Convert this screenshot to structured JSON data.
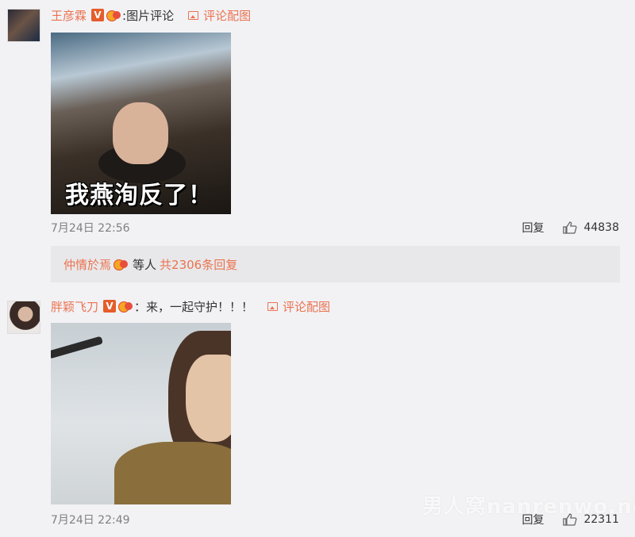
{
  "comments": [
    {
      "username": "王彦霖",
      "verified_badge": "V",
      "text": ":图片评论",
      "pic_comment_label": "评论配图",
      "photo_caption": "我燕洵反了！",
      "timestamp": "7月24日 22:56",
      "reply_label": "回复",
      "like_count": "44838"
    },
    {
      "username": "胖颖飞刀",
      "verified_badge": "V",
      "text": "：来，一起守护！！！",
      "pic_comment_label": "评论配图",
      "timestamp": "7月24日 22:49",
      "reply_label": "回复",
      "like_count": "22311"
    }
  ],
  "replies": {
    "user": "仲情於焉",
    "etc": "等人",
    "count_text": "共2306条回复"
  },
  "watermark": "男人窝nanrenwo.net",
  "icons": [
    "verified-v-icon",
    "medal-icon",
    "picture-icon",
    "thumb-up-icon"
  ],
  "colors": {
    "accent": "#eb7350",
    "background": "#f2f2f5",
    "reply_box": "#e8e8ea"
  }
}
